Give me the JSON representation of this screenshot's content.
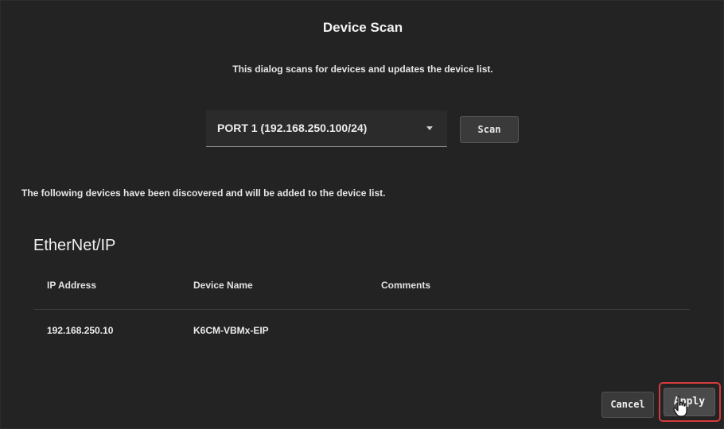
{
  "dialog": {
    "title": "Device Scan",
    "description": "This dialog scans for devices and updates the device list."
  },
  "port_select": {
    "value": "PORT 1 (192.168.250.100/24)",
    "icon": "chevron-down-icon"
  },
  "scan_label": "Scan",
  "discovered_message": "The following devices have been discovered and will be added to the device list.",
  "section": {
    "title": "EtherNet/IP",
    "columns": [
      "IP Address",
      "Device Name",
      "Comments"
    ],
    "rows": [
      {
        "ip": "192.168.250.10",
        "device_name": "K6CM-VBMx-EIP",
        "comments": ""
      }
    ]
  },
  "footer": {
    "cancel_label": "Cancel",
    "apply_label": "Apply"
  },
  "colors": {
    "background": "#232323",
    "highlight": "#d63a3a"
  },
  "cursor_icon": "hand-pointer-icon"
}
